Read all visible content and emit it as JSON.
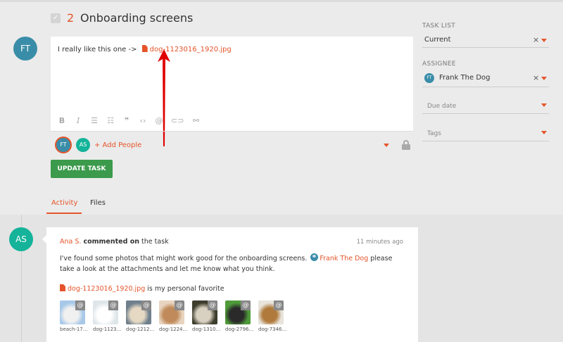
{
  "task": {
    "number": "2",
    "title": "Onboarding screens"
  },
  "editor": {
    "avatar": "FT",
    "text_prefix": "I really like this one ->",
    "attachment": "dog-1123016_1920.jpg",
    "toolbar_icons": [
      "bold-icon",
      "italic-icon",
      "bullet-list-icon",
      "numbered-list-icon",
      "quote-icon",
      "code-icon",
      "mention-icon",
      "attachment-icon",
      "link-icon"
    ]
  },
  "people": {
    "avatars": [
      "FT",
      "AS"
    ],
    "add_label": "+ Add People"
  },
  "update_button": "UPDATE TASK",
  "tabs": [
    {
      "label": "Activity",
      "active": true
    },
    {
      "label": "Files",
      "active": false
    }
  ],
  "sidebar": {
    "task_list_label": "TASK LIST",
    "task_list_value": "Current",
    "assignee_label": "ASSIGNEE",
    "assignee_avatar": "FT",
    "assignee_value": "Frank The Dog",
    "due_date_placeholder": "Due date",
    "tags_placeholder": "Tags",
    "clear_glyph": "×"
  },
  "activity": {
    "avatar": "AS",
    "author": "Ana S.",
    "action": "commented on",
    "target": "the task",
    "time": "11 minutes ago",
    "body_before": "I've found some photos that might work good for the onboarding screens.",
    "mention": "Frank The Dog",
    "body_after": "please take a look at the attachments and let me know what you think.",
    "favorite_file": "dog-1123016_1920.jpg",
    "favorite_suffix": "is my personal favorite",
    "thumbnails": [
      {
        "caption": "beach-17...",
        "colors": [
          "#a8c8e8",
          "#f0f0f0"
        ]
      },
      {
        "caption": "dog-1123...",
        "colors": [
          "#dfe6ea",
          "#ffffff"
        ]
      },
      {
        "caption": "dog-1212...",
        "colors": [
          "#6f7f8c",
          "#e6d9c4"
        ]
      },
      {
        "caption": "dog-1224...",
        "colors": [
          "#e8d4c0",
          "#c08a5a"
        ]
      },
      {
        "caption": "dog-1310...",
        "colors": [
          "#3d3d2e",
          "#d8d0c0"
        ]
      },
      {
        "caption": "dog-2796...",
        "colors": [
          "#4f9a3a",
          "#2a2a2a"
        ]
      },
      {
        "caption": "dog-7346...",
        "colors": [
          "#e8e4dc",
          "#b07a3c"
        ]
      }
    ],
    "thumb_badge": "@"
  },
  "colors": {
    "accent": "#e5542b",
    "button": "#3b9a4b",
    "avatar_ft": "#3a8da8",
    "avatar_as": "#14b39a"
  }
}
